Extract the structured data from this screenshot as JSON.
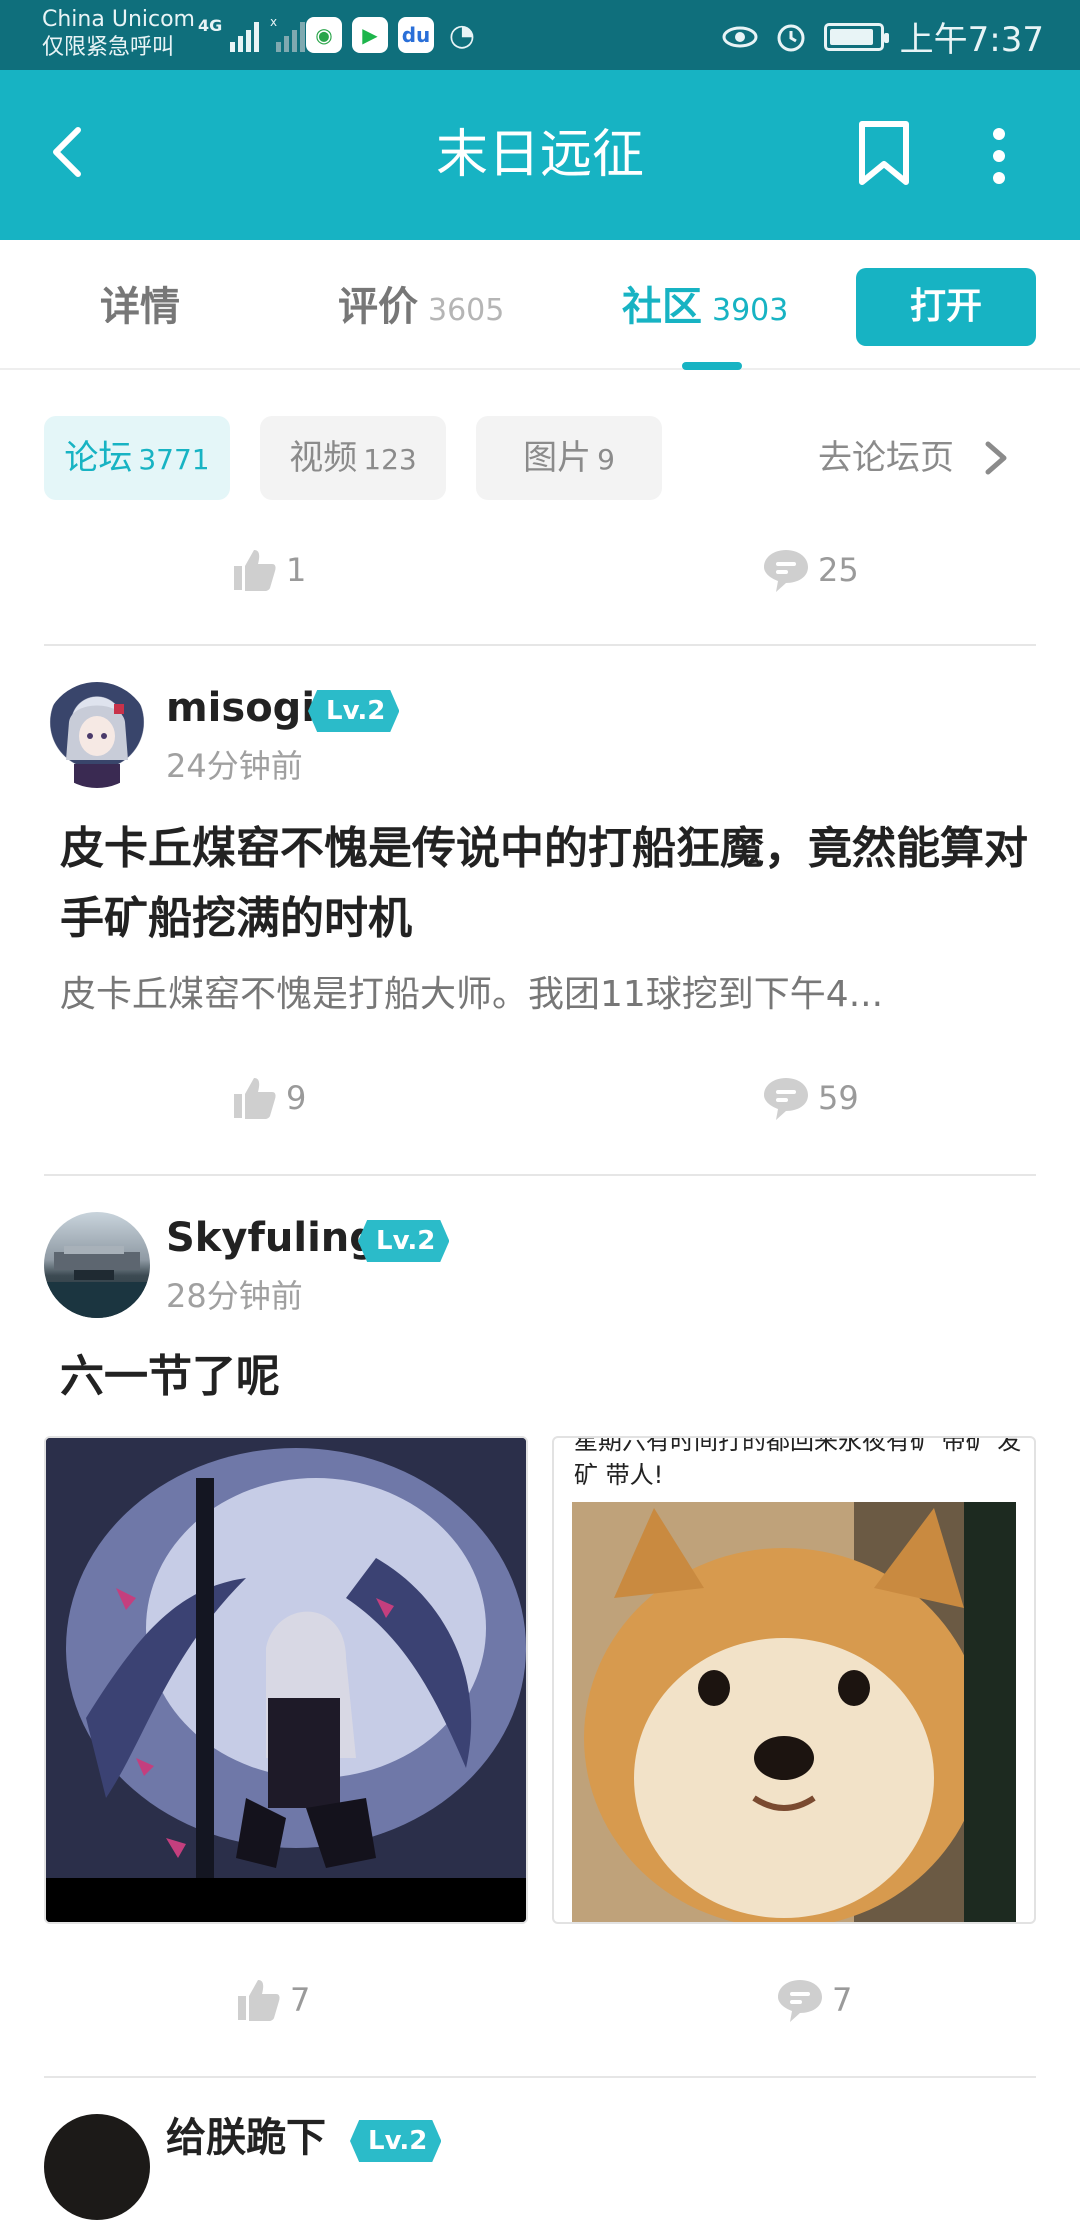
{
  "status_bar": {
    "carrier_line1": "China Unicom",
    "carrier_line2": "仅限紧急呼叫",
    "network": "4G",
    "time": "上午7:37",
    "battery_level": 0.9
  },
  "header": {
    "title": "末日远征",
    "accent_color": "#17b3c3"
  },
  "tabs": [
    {
      "label": "详情",
      "count": ""
    },
    {
      "label": "评价",
      "count": "3605"
    },
    {
      "label": "社区",
      "count": "3903",
      "active": true
    }
  ],
  "open_button": "打开",
  "filters": [
    {
      "label": "论坛",
      "count": "3771",
      "active": true
    },
    {
      "label": "视频",
      "count": "123"
    },
    {
      "label": "图片",
      "count": "9"
    }
  ],
  "goto_forum": "去论坛页",
  "top_actions": {
    "likes": "1",
    "comments": "25"
  },
  "posts": [
    {
      "username": "misogi",
      "level": "Lv.2",
      "time": "24分钟前",
      "title": "皮卡丘煤窑不愧是传说中的打船狂魔，竟然能算对手矿船挖满的时机",
      "excerpt": "皮卡丘煤窑不愧是打船大师。我团11球挖到下午4...",
      "likes": "9",
      "comments": "59"
    },
    {
      "username": "Skyfuling",
      "level": "Lv.2",
      "time": "28分钟前",
      "title": "六一节了呢",
      "meme_text": "星期六有时间打的都回来永夜有矿 带矿 发矿 带人!",
      "likes": "7",
      "comments": "7"
    },
    {
      "username": "给朕跪下",
      "level": "Lv.2"
    }
  ]
}
